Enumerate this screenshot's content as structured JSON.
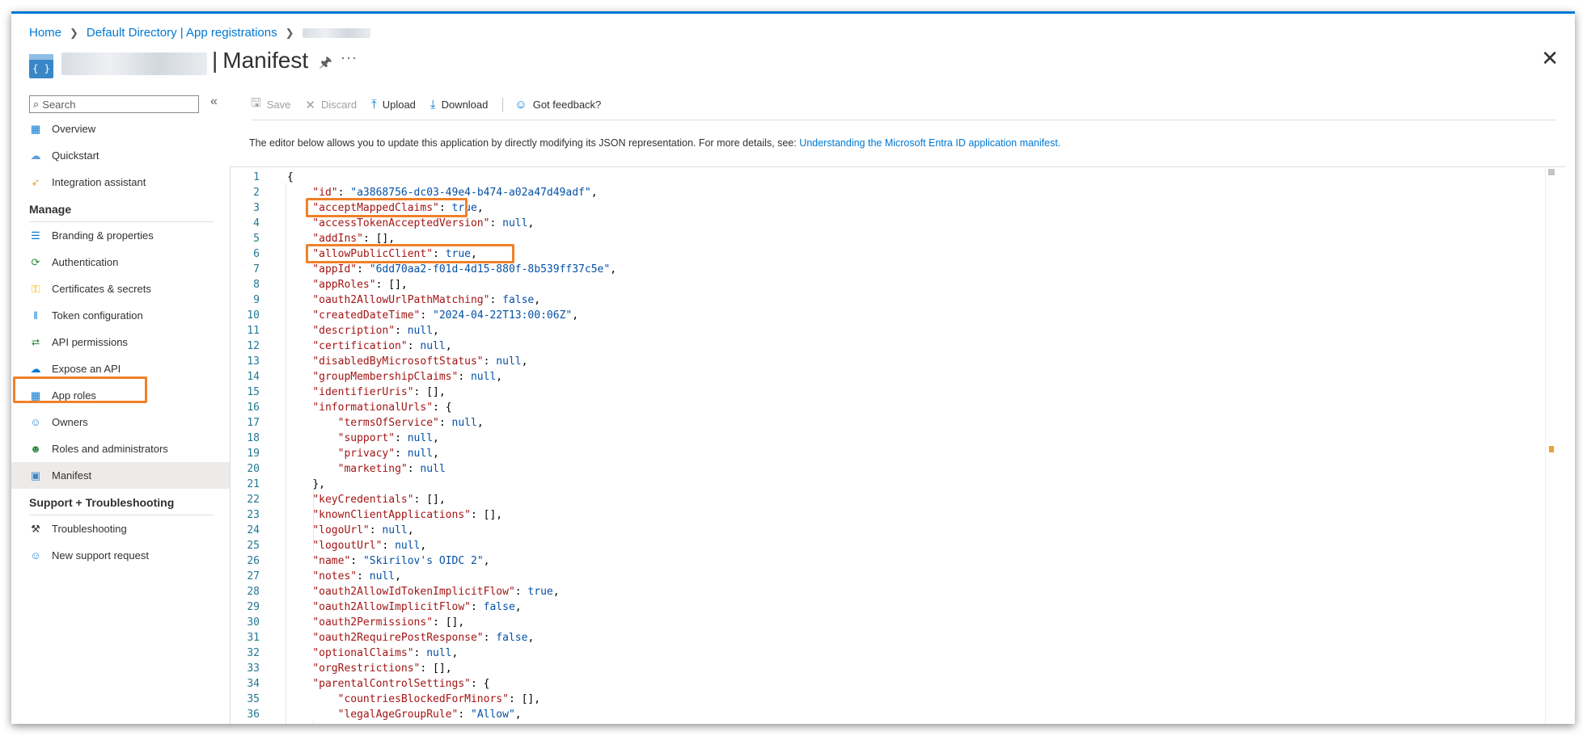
{
  "breadcrumb": {
    "home": "Home",
    "directory": "Default Directory | App registrations"
  },
  "header": {
    "title": "Manifest",
    "separator": "|",
    "icon_text": "{ }",
    "more": "···",
    "close": "✕"
  },
  "sidebar": {
    "search_placeholder": "Search",
    "collapse": "«",
    "items_top": [
      {
        "label": "Overview",
        "icon": "grid-icon",
        "color": "#0078d4"
      },
      {
        "label": "Quickstart",
        "icon": "cloud-icon",
        "color": "#5ea0d8"
      },
      {
        "label": "Integration assistant",
        "icon": "rocket-icon",
        "color": "#e8a33c"
      }
    ],
    "manage_heading": "Manage",
    "items_manage": [
      {
        "label": "Branding & properties",
        "icon": "branding-icon"
      },
      {
        "label": "Authentication",
        "icon": "authentication-icon"
      },
      {
        "label": "Certificates & secrets",
        "icon": "key-icon"
      },
      {
        "label": "Token configuration",
        "icon": "token-icon"
      },
      {
        "label": "API permissions",
        "icon": "permissions-icon"
      },
      {
        "label": "Expose an API",
        "icon": "cloud-api-icon"
      },
      {
        "label": "App roles",
        "icon": "app-roles-icon"
      },
      {
        "label": "Owners",
        "icon": "owners-icon"
      },
      {
        "label": "Roles and administrators",
        "icon": "roles-icon"
      },
      {
        "label": "Manifest",
        "icon": "manifest-icon"
      }
    ],
    "support_heading": "Support + Troubleshooting",
    "items_support": [
      {
        "label": "Troubleshooting",
        "icon": "wrench-icon"
      },
      {
        "label": "New support request",
        "icon": "support-person-icon"
      }
    ]
  },
  "toolbar": {
    "save": "Save",
    "discard": "Discard",
    "upload": "Upload",
    "download": "Download",
    "feedback": "Got feedback?"
  },
  "description": {
    "text": "The editor below allows you to update this application by directly modifying its JSON representation. For more details, see: ",
    "link": "Understanding the Microsoft Entra ID application manifest."
  },
  "editor": {
    "lines": [
      {
        "n": "1",
        "indent": 0,
        "raw": "{"
      },
      {
        "n": "2",
        "indent": 1,
        "key": "id",
        "str": "a3868756-dc03-49e4-b474-a02a47d49adf",
        "end": ","
      },
      {
        "n": "3",
        "indent": 1,
        "key": "acceptMappedClaims",
        "val": "true",
        "end": ","
      },
      {
        "n": "4",
        "indent": 1,
        "key": "accessTokenAcceptedVersion",
        "val": "null",
        "end": ","
      },
      {
        "n": "5",
        "indent": 1,
        "key": "addIns",
        "raw2": "[]",
        "end": ","
      },
      {
        "n": "6",
        "indent": 1,
        "key": "allowPublicClient",
        "val": "true",
        "end": ","
      },
      {
        "n": "7",
        "indent": 1,
        "key": "appId",
        "str": "6dd70aa2-f01d-4d15-880f-8b539ff37c5e",
        "end": ","
      },
      {
        "n": "8",
        "indent": 1,
        "key": "appRoles",
        "raw2": "[]",
        "end": ","
      },
      {
        "n": "9",
        "indent": 1,
        "key": "oauth2AllowUrlPathMatching",
        "val": "false",
        "end": ","
      },
      {
        "n": "10",
        "indent": 1,
        "key": "createdDateTime",
        "str": "2024-04-22T13:00:06Z",
        "end": ","
      },
      {
        "n": "11",
        "indent": 1,
        "key": "description",
        "val": "null",
        "end": ","
      },
      {
        "n": "12",
        "indent": 1,
        "key": "certification",
        "val": "null",
        "end": ","
      },
      {
        "n": "13",
        "indent": 1,
        "key": "disabledByMicrosoftStatus",
        "val": "null",
        "end": ","
      },
      {
        "n": "14",
        "indent": 1,
        "key": "groupMembershipClaims",
        "val": "null",
        "end": ","
      },
      {
        "n": "15",
        "indent": 1,
        "key": "identifierUris",
        "raw2": "[]",
        "end": ","
      },
      {
        "n": "16",
        "indent": 1,
        "key": "informationalUrls",
        "raw2": "{",
        "end": ""
      },
      {
        "n": "17",
        "indent": 2,
        "key": "termsOfService",
        "val": "null",
        "end": ","
      },
      {
        "n": "18",
        "indent": 2,
        "key": "support",
        "val": "null",
        "end": ","
      },
      {
        "n": "19",
        "indent": 2,
        "key": "privacy",
        "val": "null",
        "end": ","
      },
      {
        "n": "20",
        "indent": 2,
        "key": "marketing",
        "val": "null",
        "end": ""
      },
      {
        "n": "21",
        "indent": 1,
        "raw": "},"
      },
      {
        "n": "22",
        "indent": 1,
        "key": "keyCredentials",
        "raw2": "[]",
        "end": ","
      },
      {
        "n": "23",
        "indent": 1,
        "key": "knownClientApplications",
        "raw2": "[]",
        "end": ","
      },
      {
        "n": "24",
        "indent": 1,
        "key": "logoUrl",
        "val": "null",
        "end": ","
      },
      {
        "n": "25",
        "indent": 1,
        "key": "logoutUrl",
        "val": "null",
        "end": ","
      },
      {
        "n": "26",
        "indent": 1,
        "key": "name",
        "str": "Skirilov's OIDC 2",
        "end": ","
      },
      {
        "n": "27",
        "indent": 1,
        "key": "notes",
        "val": "null",
        "end": ","
      },
      {
        "n": "28",
        "indent": 1,
        "key": "oauth2AllowIdTokenImplicitFlow",
        "val": "true",
        "end": ","
      },
      {
        "n": "29",
        "indent": 1,
        "key": "oauth2AllowImplicitFlow",
        "val": "false",
        "end": ","
      },
      {
        "n": "30",
        "indent": 1,
        "key": "oauth2Permissions",
        "raw2": "[]",
        "end": ","
      },
      {
        "n": "31",
        "indent": 1,
        "key": "oauth2RequirePostResponse",
        "val": "false",
        "end": ","
      },
      {
        "n": "32",
        "indent": 1,
        "key": "optionalClaims",
        "val": "null",
        "end": ","
      },
      {
        "n": "33",
        "indent": 1,
        "key": "orgRestrictions",
        "raw2": "[]",
        "end": ","
      },
      {
        "n": "34",
        "indent": 1,
        "key": "parentalControlSettings",
        "raw2": "{",
        "end": ""
      },
      {
        "n": "35",
        "indent": 2,
        "key": "countriesBlockedForMinors",
        "raw2": "[]",
        "end": ","
      },
      {
        "n": "36",
        "indent": 2,
        "key": "legalAgeGroupRule",
        "str": "Allow",
        "end": ","
      }
    ]
  }
}
